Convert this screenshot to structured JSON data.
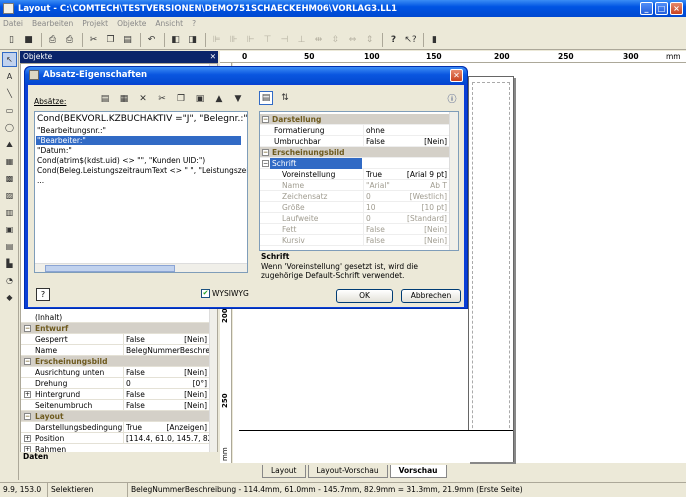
{
  "window": {
    "title": "Layout - C:\\COMTECH\\TESTVERSIONEN\\DEMO751SCHAECKEHM06\\VORLAG3.LL1"
  },
  "menu": [
    "Datei",
    "Bearbeiten",
    "Projekt",
    "Objekte",
    "Ansicht",
    "?"
  ],
  "objects_panel": {
    "title": "Objekte",
    "rows": [
      {
        "type": "row",
        "key": "(Inhalt)",
        "value": "",
        "unit": ""
      },
      {
        "type": "cat",
        "key": "Entwurf"
      },
      {
        "type": "row",
        "key": "Gesperrt",
        "value": "False",
        "unit": "[Nein]"
      },
      {
        "type": "row",
        "key": "Name",
        "value": "BelegNummerBeschreib...",
        "unit": ""
      },
      {
        "type": "cat",
        "key": "Erscheinungsbild"
      },
      {
        "type": "row",
        "key": "Ausrichtung unten",
        "value": "False",
        "unit": "[Nein]"
      },
      {
        "type": "row",
        "key": "Drehung",
        "value": "0",
        "unit": "[0°]"
      },
      {
        "type": "row",
        "key": "Hintergrund",
        "value": "False",
        "unit": "[Nein]",
        "expand": true
      },
      {
        "type": "row",
        "key": "Seitenumbruch",
        "value": "False",
        "unit": "[Nein]"
      },
      {
        "type": "cat",
        "key": "Layout"
      },
      {
        "type": "row",
        "key": "Darstellungsbedingung",
        "value": "True",
        "unit": "[Anzeigen]"
      },
      {
        "type": "row",
        "key": "Position",
        "value": "[114.4, 61.0, 145.7, 82....",
        "unit": "",
        "expand": true
      },
      {
        "type": "row",
        "key": "Rahmen",
        "value": "",
        "unit": "",
        "expand": true
      }
    ],
    "footer": "Daten"
  },
  "ruler": {
    "labels": [
      "0",
      "50",
      "100",
      "150",
      "200",
      "250",
      "300",
      "mm"
    ],
    "vlabels": [
      "250",
      "200",
      "mm"
    ]
  },
  "tabs": [
    "Layout",
    "Layout-Vorschau",
    "Vorschau"
  ],
  "status": {
    "coords": "9.9, 153.0",
    "mode": "Selektieren",
    "info": "BelegNummerBeschreibung - 114.4mm, 61.0mm - 145.7mm, 82.9mm = 31.3mm, 21.9mm (Erste Seite)"
  },
  "dialog": {
    "title": "Absatz-Eigenschaften",
    "absaetze_label": "Absätze:",
    "editor_lines": [
      "Cond(BEKVORL.KZBUCHAKTIV =\"J\", \"Belegnr.:\")",
      "\"Bearbeitungsnr.:\"",
      "\"Bearbeiter:\"",
      "\"Datum:\"",
      "Cond(atrim$(kdst.uid) <> \"\", \"Kunden UID:\")",
      "Cond(Beleg.LeistungszeitraumText <> \" \", \"Leistungszeitra",
      "..."
    ],
    "wysiwyg_label": "WYSIWYG",
    "ok_label": "OK",
    "cancel_label": "Abbrechen",
    "help_label": "?",
    "grid": [
      {
        "type": "cat",
        "key": "Darstellung"
      },
      {
        "type": "row",
        "key": "Formatierung",
        "value": "ohne",
        "unit": ""
      },
      {
        "type": "row",
        "key": "Umbruchbar",
        "value": "False",
        "unit": "[Nein]"
      },
      {
        "type": "cat",
        "key": "Erscheinungsbild"
      },
      {
        "type": "sel",
        "key": "Schrift",
        "value": "",
        "unit": "[Arial]"
      },
      {
        "type": "row",
        "key": "Voreinstellung",
        "value": "True",
        "unit": "[Arial 9 pt]",
        "indent": true
      },
      {
        "type": "dis",
        "key": "Name",
        "value": "\"Arial\"",
        "unit": "Ab T"
      },
      {
        "type": "dis",
        "key": "Zeichensatz",
        "value": "0",
        "unit": "[Westlich]"
      },
      {
        "type": "dis",
        "key": "Größe",
        "value": "10",
        "unit": "[10 pt]"
      },
      {
        "type": "dis",
        "key": "Laufweite",
        "value": "0",
        "unit": "[Standard]"
      },
      {
        "type": "dis",
        "key": "Fett",
        "value": "False",
        "unit": "[Nein]"
      },
      {
        "type": "dis",
        "key": "Kursiv",
        "value": "False",
        "unit": "[Nein]"
      }
    ],
    "desc_title": "Schrift",
    "desc_text": "Wenn 'Voreinstellung' gesetzt ist, wird die zugehörige Default-Schrift verwendet."
  }
}
